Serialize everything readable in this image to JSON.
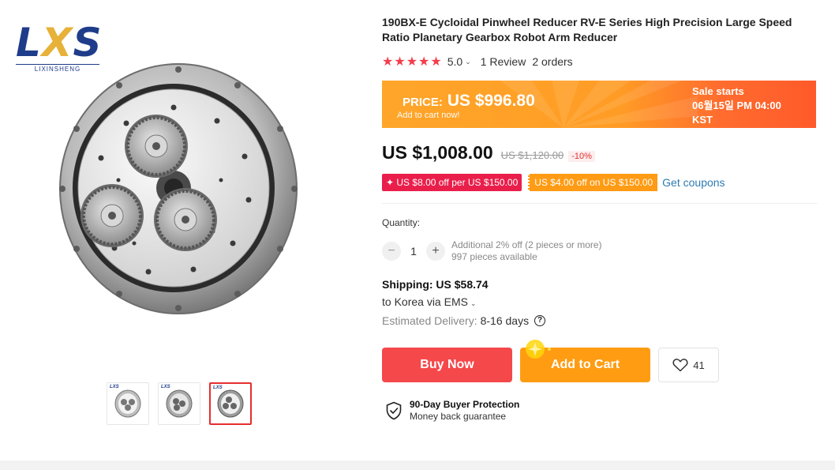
{
  "brand": {
    "logo_text": "LXS",
    "logo_sub": "LIXINSHENG"
  },
  "gallery": {
    "thumbnails": [
      {
        "label": "LXS",
        "active": false
      },
      {
        "label": "LXS",
        "active": false
      },
      {
        "label": "LXS",
        "active": true
      }
    ]
  },
  "product": {
    "title": "190BX-E Cycloidal Pinwheel Reducer RV-E Series High Precision Large Speed Ratio Planetary Gearbox Robot Arm Reducer",
    "rating": {
      "stars": "★★★★★",
      "score": "5.0",
      "reviews": "1 Review",
      "orders": "2 orders"
    }
  },
  "promo": {
    "price_label": "PRICE:",
    "price_value": "US $996.80",
    "subtext": "Add to cart now!",
    "sale_line1": "Sale starts",
    "sale_line2": "06월15일 PM 04:00",
    "sale_line3": "KST"
  },
  "pricing": {
    "price": "US $1,008.00",
    "original": "US $1,120.00",
    "discount": "-10%"
  },
  "coupons": {
    "store_coupon": "✦ US $8.00 off per US $150.00",
    "select_coupon": "US $4.00 off on US $150.00",
    "get_coupons": "Get coupons"
  },
  "quantity": {
    "label": "Quantity:",
    "minus": "−",
    "value": "1",
    "plus": "+",
    "note_line1": "Additional 2% off (2 pieces or more)",
    "note_line2": "997 pieces available"
  },
  "shipping": {
    "title": "Shipping: US $58.74",
    "destination": "to Korea via EMS",
    "delivery_label": "Estimated Delivery:",
    "delivery_value": "8-16 days",
    "help": "?"
  },
  "actions": {
    "buy_now": "Buy Now",
    "add_to_cart": "Add to Cart",
    "wishlist_count": "41"
  },
  "protection": {
    "title": "90-Day Buyer Protection",
    "subtitle": "Money back guarantee"
  },
  "colors": {
    "accent_red": "#f5484b",
    "accent_orange": "#ff9c12",
    "star_red": "#f53d4b",
    "coupon_pink": "#ea1e4a",
    "link_blue": "#2e7bb3",
    "brand_blue": "#1f3c8a"
  },
  "icons": [
    "caret-down-icon",
    "help-icon",
    "heart-icon",
    "shield-check-icon",
    "sparkle-icon"
  ]
}
